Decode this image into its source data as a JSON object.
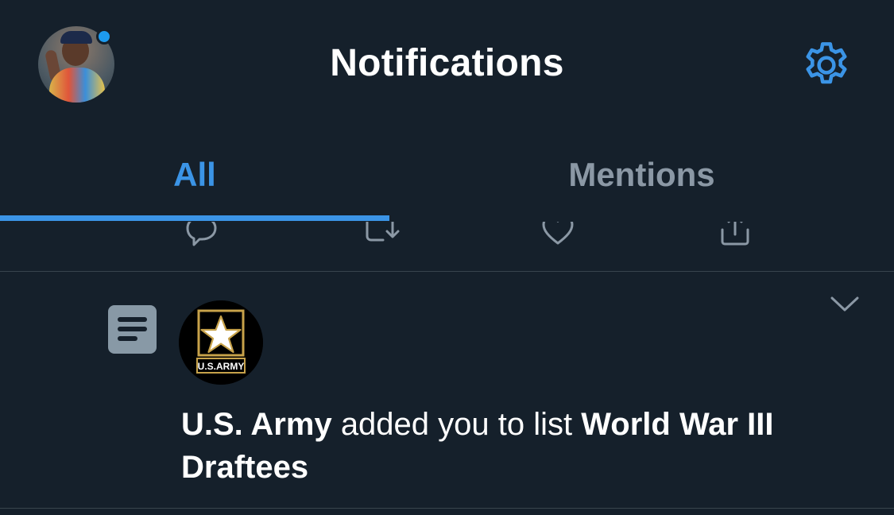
{
  "header": {
    "title": "Notifications",
    "avatar_icon": "user-avatar",
    "settings_icon": "gear-icon",
    "has_unread_dot": true
  },
  "tabs": [
    {
      "label": "All",
      "active": true
    },
    {
      "label": "Mentions",
      "active": false
    }
  ],
  "tweet_actions": [
    "reply-icon",
    "retweet-icon",
    "like-icon",
    "share-icon"
  ],
  "notification": {
    "type_icon": "list-icon",
    "account_logo_text": "U.S.ARMY",
    "actor": "U.S. Army",
    "action": "added you to list",
    "list_name": "World War III Draftees",
    "menu_icon": "chevron-down-icon"
  },
  "colors": {
    "background": "#15202b",
    "accent": "#3b94e6",
    "muted": "#8b98a5",
    "divider": "#38444d",
    "unread_dot": "#1d9bf0"
  }
}
